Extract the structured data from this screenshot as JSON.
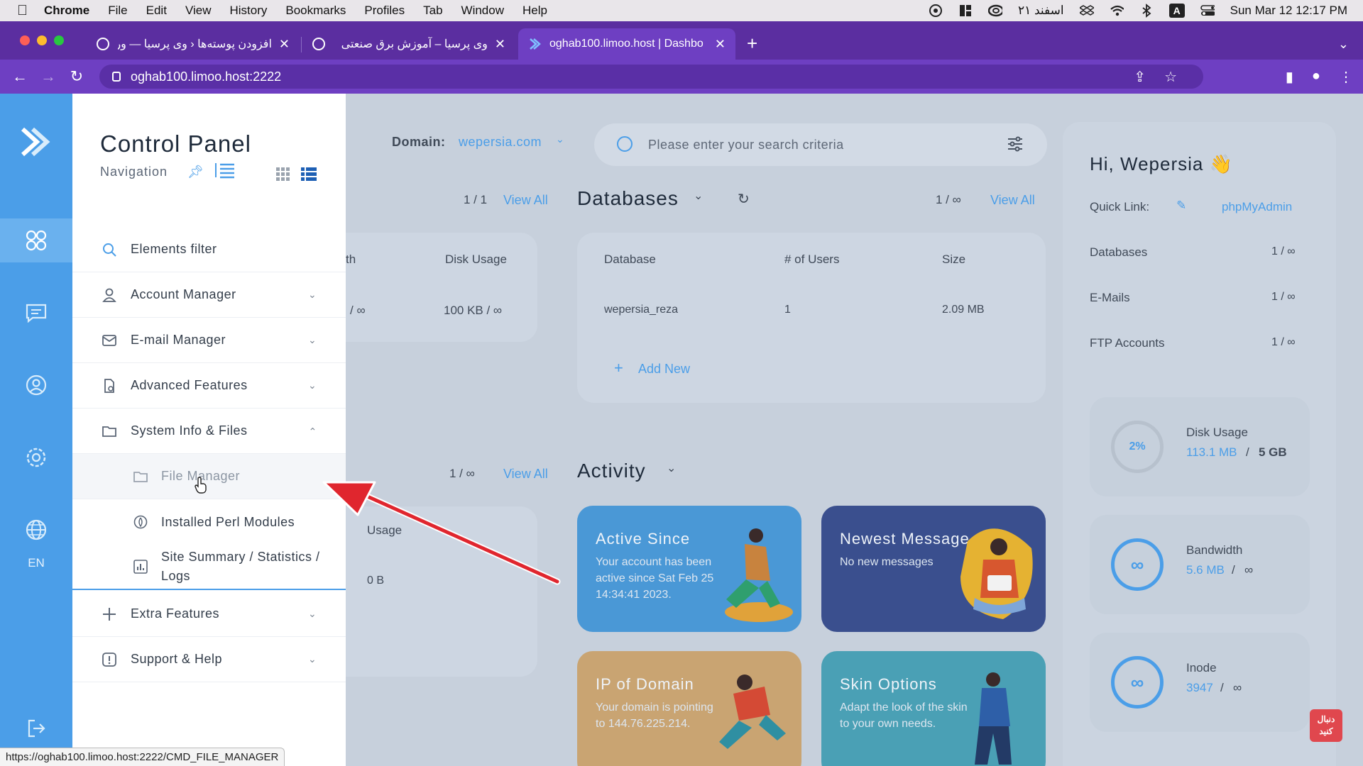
{
  "menubar": {
    "app": "Chrome",
    "items": [
      "File",
      "Edit",
      "View",
      "History",
      "Bookmarks",
      "Profiles",
      "Tab",
      "Window",
      "Help"
    ],
    "persian_date": "۲۱ اسفند",
    "clock": "Sun Mar 12  12:17 PM",
    "input_badge": "A"
  },
  "browser": {
    "tabs": [
      {
        "title": "افزودن پوسته‌ها ‹ وی پرسیا — وردپر",
        "active": false
      },
      {
        "title": "وی پرسیا – آموزش برق صنعتی",
        "active": false
      },
      {
        "title": "oghab100.limoo.host | Dashbo",
        "active": true
      }
    ],
    "new_tab": "+",
    "url": "oghab100.limoo.host:2222",
    "status_url": "https://oghab100.limoo.host:2222/CMD_FILE_MANAGER"
  },
  "rail": {
    "lang": "EN",
    "icons": [
      "dashboard-icon",
      "message-icon",
      "user-icon",
      "settings-icon",
      "globe-icon",
      "logout-icon"
    ]
  },
  "drawer": {
    "title": "Control Panel",
    "subtitle": "Navigation",
    "filter_label": "Elements filter",
    "items": [
      {
        "label": "Account Manager",
        "icon": "user-icon"
      },
      {
        "label": "E-mail Manager",
        "icon": "mail-icon"
      },
      {
        "label": "Advanced Features",
        "icon": "advanced-icon"
      },
      {
        "label": "System Info & Files",
        "icon": "folder-icon"
      }
    ],
    "sub_items": [
      {
        "label": "File Manager",
        "icon": "folder-icon"
      },
      {
        "label": "Installed Perl Modules",
        "icon": "perl-icon"
      },
      {
        "label": "Site Summary / Statistics / Logs",
        "icon": "stats-icon"
      }
    ],
    "bottom_items": [
      {
        "label": "Extra Features",
        "icon": "plus-icon"
      },
      {
        "label": "Support & Help",
        "icon": "help-icon"
      }
    ]
  },
  "main": {
    "domain_label": "Domain:",
    "domain_value": "wepersia.com",
    "search_placeholder": "Please enter your search criteria",
    "left_counter_top": "1  /  1",
    "view_all": "View All",
    "left_table": {
      "col1": "th",
      "col2": "Disk Usage",
      "val1": "/  ∞",
      "val2": "100 KB  /  ∞"
    },
    "databases": {
      "title": "Databases",
      "counter": "1  /  ∞",
      "headers": [
        "Database",
        "# of Users",
        "Size"
      ],
      "row": [
        "wepersia_reza",
        "1",
        "2.09 MB"
      ],
      "add_new": "Add New"
    },
    "left_counter_bottom": "1  /  ∞",
    "left_usage": {
      "header": "Usage",
      "value": "0 B"
    },
    "activity": {
      "title": "Activity",
      "tiles": [
        {
          "title": "Active Since",
          "desc": "Your account has been active since Sat Feb 25 14:34:41 2023.",
          "color": "#4a98d6"
        },
        {
          "title": "Newest Message",
          "desc": "No new messages",
          "color": "#3a4f8e"
        },
        {
          "title": "IP of Domain",
          "desc": "Your domain is pointing to 144.76.225.214.",
          "color": "#c9a472"
        },
        {
          "title": "Skin Options",
          "desc": "Adapt the look of the skin to your own needs.",
          "color": "#4aa0b5"
        }
      ]
    }
  },
  "right_panel": {
    "greeting": "Hi, Wepersia 👋",
    "quick_link_label": "Quick Link:",
    "quick_link": "phpMyAdmin",
    "stats": [
      {
        "label": "Databases",
        "value": "1 / ∞"
      },
      {
        "label": "E-Mails",
        "value": "1 / ∞"
      },
      {
        "label": "FTP Accounts",
        "value": "1 / ∞"
      }
    ],
    "usage": [
      {
        "label": "Disk Usage",
        "ring": "2%",
        "used": "113.1 MB",
        "sep": "/",
        "total": "5 GB"
      },
      {
        "label": "Bandwidth",
        "ring": "∞",
        "used": "5.6 MB",
        "sep": "/",
        "total": "∞"
      },
      {
        "label": "Inode",
        "ring": "∞",
        "used": "3947",
        "sep": "/",
        "total": "∞"
      }
    ]
  },
  "watermark": "دنبال کنید",
  "colors": {
    "accent": "#4b9ee8",
    "chrome_purple": "#6e3fc2",
    "arrow": "#e0262e"
  }
}
